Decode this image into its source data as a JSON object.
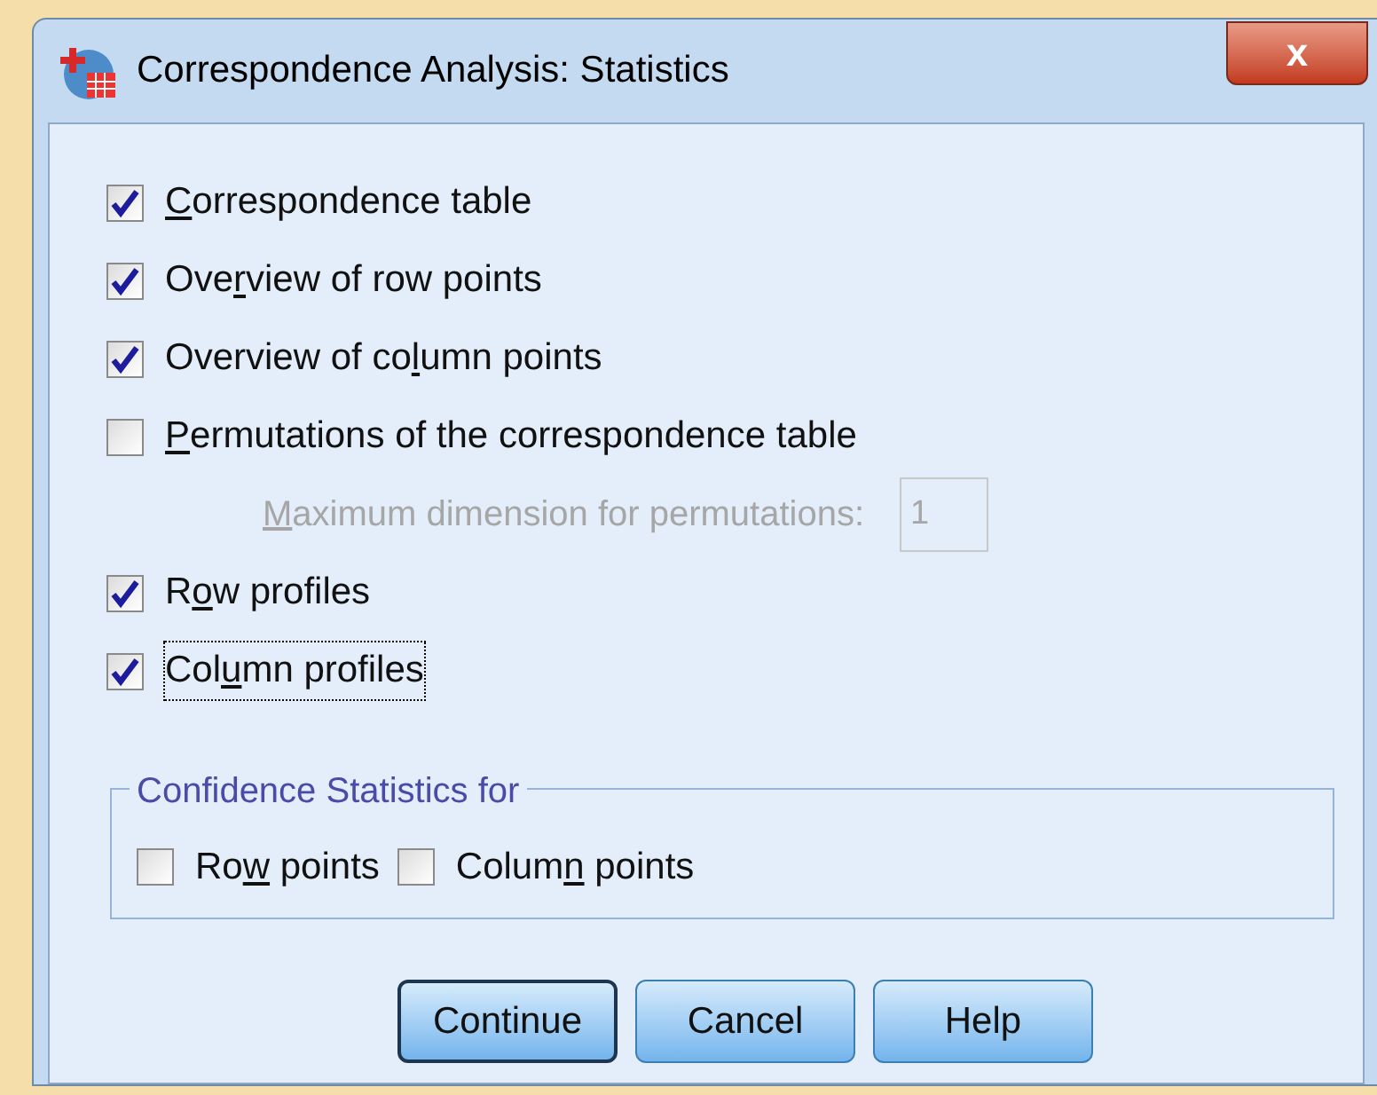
{
  "window": {
    "title": "Correspondence Analysis: Statistics",
    "close_label": "x"
  },
  "options": [
    {
      "access_key": "C",
      "label_end": "orrespondence table",
      "checked": true,
      "focused": false
    },
    {
      "label_start": "Ove",
      "access_key": "r",
      "label_end": "view of row points",
      "checked": true,
      "focused": false
    },
    {
      "label_start": "Overview of co",
      "access_key": "l",
      "label_end": "umn points",
      "checked": true,
      "focused": false
    },
    {
      "access_key": "P",
      "label_end": "ermutations of the correspondence table",
      "checked": false,
      "focused": false,
      "sub_field": {
        "access_key": "M",
        "label_end": "aximum dimension for permutations:",
        "value": "1",
        "disabled": true
      }
    },
    {
      "label_start": "R",
      "access_key": "o",
      "label_end": "w profiles",
      "checked": true,
      "focused": false
    },
    {
      "label_start": "Col",
      "access_key": "u",
      "label_end": "mn profiles",
      "checked": true,
      "focused": true
    }
  ],
  "confidence_group": {
    "title": "Confidence Statistics for",
    "options": [
      {
        "label_start": "Ro",
        "access_key": "w",
        "label_end": " points",
        "checked": false
      },
      {
        "label_start": "Colum",
        "access_key": "n",
        "label_end": " points",
        "checked": false
      }
    ]
  },
  "buttons": [
    {
      "label": "Continue",
      "default": true
    },
    {
      "label": "Cancel",
      "default": false
    },
    {
      "label": "Help",
      "default": false
    }
  ]
}
